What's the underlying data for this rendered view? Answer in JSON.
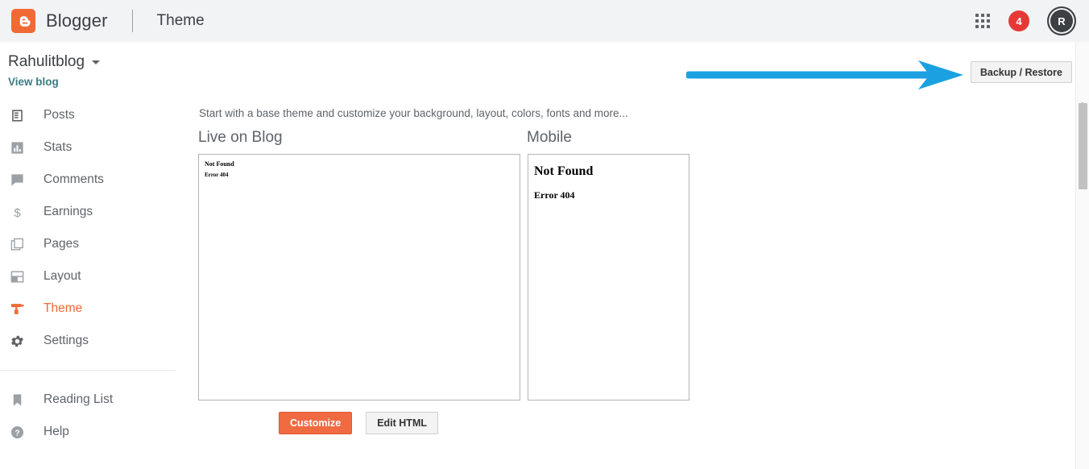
{
  "topbar": {
    "brand_name": "Blogger",
    "page_title": "Theme",
    "logo_icon": "blogger-logo-icon",
    "apps_icon": "apps-grid-icon",
    "notification_count": "4",
    "avatar_initial": "R",
    "background_color": "#f1f3f4",
    "brand_color": "#f06a35"
  },
  "sidebar": {
    "blog_name": "Rahulitblog",
    "blog_switcher_icon": "chevron-down-icon",
    "view_blog_label": "View blog",
    "view_blog_color": "#3d7b80",
    "active_item": "Theme",
    "active_color": "#f06a35",
    "items": [
      {
        "label": "Posts",
        "icon": "posts-icon"
      },
      {
        "label": "Stats",
        "icon": "stats-icon"
      },
      {
        "label": "Comments",
        "icon": "comments-icon"
      },
      {
        "label": "Earnings",
        "icon": "earnings-icon"
      },
      {
        "label": "Pages",
        "icon": "pages-icon"
      },
      {
        "label": "Layout",
        "icon": "layout-icon"
      },
      {
        "label": "Theme",
        "icon": "theme-icon"
      },
      {
        "label": "Settings",
        "icon": "settings-gear-icon"
      }
    ],
    "secondary_items": [
      {
        "label": "Reading List",
        "icon": "bookmark-icon"
      },
      {
        "label": "Help",
        "icon": "help-circle-icon"
      }
    ]
  },
  "main": {
    "backup_restore_label": "Backup / Restore",
    "intro_text": "Start with a base theme and customize your background, layout, colors, fonts and more...",
    "annotation": {
      "type": "arrow",
      "color": "#1BA1E2",
      "points_to": "Backup / Restore"
    },
    "previews": [
      {
        "heading": "Live on Blog",
        "body_title": "Not Found",
        "body_subtitle": "Error 404"
      },
      {
        "heading": "Mobile",
        "body_title": "Not Found",
        "body_subtitle": "Error 404"
      }
    ],
    "buttons": {
      "customize_label": "Customize",
      "customize_color": "#f06a42",
      "edit_html_label": "Edit HTML"
    }
  },
  "scrollbar": {
    "up_arrow_icon": "scroll-up-arrow-icon",
    "thumb_position": "top"
  }
}
